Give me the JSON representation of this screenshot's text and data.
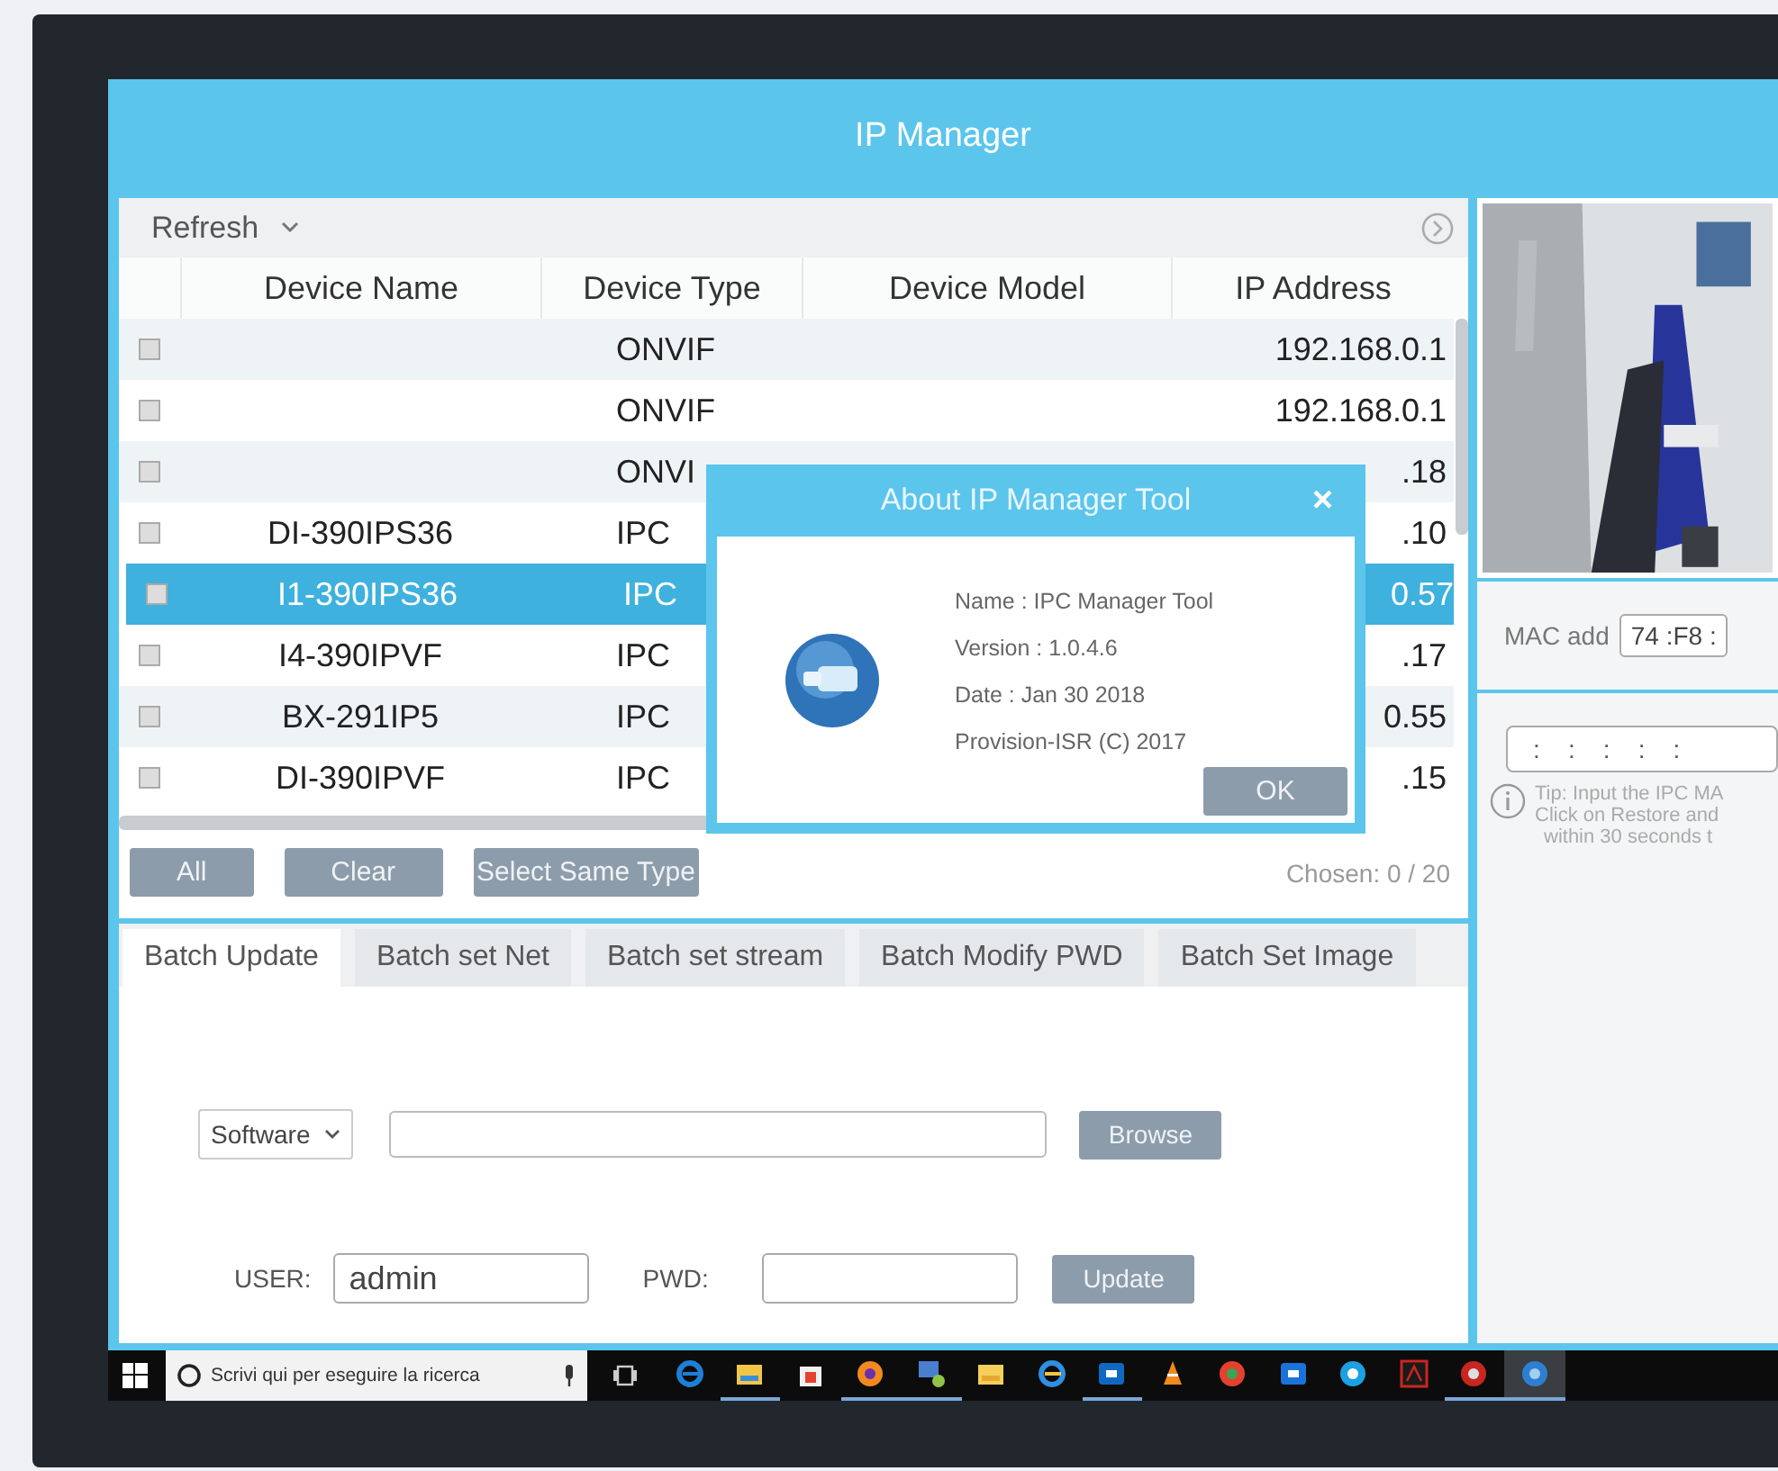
{
  "window": {
    "title": "IP Manager"
  },
  "toolbar": {
    "refresh": "Refresh"
  },
  "table": {
    "columns": [
      "Device Name",
      "Device Type",
      "Device Model",
      "IP Address"
    ],
    "rows": [
      {
        "checked": false,
        "selected": false,
        "type": "ONVIF",
        "ip": "192.168.0.1"
      },
      {
        "checked": false,
        "selected": false,
        "type": "ONVIF",
        "ip": "192.168.0.1"
      },
      {
        "checked": false,
        "selected": false,
        "type": "ONVI",
        "ip": ".18"
      },
      {
        "checked": false,
        "selected": false,
        "name": "DI-390IPS36",
        "type": "IPC",
        "ip": ".10"
      },
      {
        "checked": false,
        "selected": true,
        "name": "I1-390IPS36",
        "type": "IPC",
        "ip": "0.57"
      },
      {
        "checked": false,
        "selected": false,
        "name": "I4-390IPVF",
        "type": "IPC",
        "ip": ".17"
      },
      {
        "checked": false,
        "selected": false,
        "name": "BX-291IP5",
        "type": "IPC",
        "ip": "0.55"
      },
      {
        "checked": false,
        "selected": false,
        "name": "DI-390IPVF",
        "type": "IPC",
        "ip": ".15"
      }
    ]
  },
  "dialog": {
    "title": "About IP Manager Tool",
    "close": "×",
    "lines": [
      "Name : IPC Manager Tool",
      "Version : 1.0.4.6",
      "Date : Jan 30 2018",
      "Provision-ISR (C) 2017"
    ],
    "ok": "OK"
  },
  "actions": {
    "buttons": [
      "All",
      "Clear",
      "Select Same Type"
    ],
    "chosen": "Chosen:  0 / 20"
  },
  "mac": {
    "label": "MAC add",
    "value": "74 :F8 :",
    "second": ":    :    :    :    :"
  },
  "tip": [
    "Tip: Input the IPC MA",
    "Click on Restore and",
    "within 30 seconds t"
  ],
  "tabs": [
    {
      "label": "Batch Update",
      "selected": true
    },
    {
      "label": "Batch set Net",
      "selected": false
    },
    {
      "label": "Batch set stream",
      "selected": false
    },
    {
      "label": "Batch Modify PWD",
      "selected": false
    },
    {
      "label": "Batch Set Image",
      "selected": false
    }
  ],
  "form": {
    "select": "Software",
    "browse": "Browse",
    "user_label": "USER:",
    "user": "admin",
    "pwd_label": "PWD:",
    "update": "Update"
  },
  "taskbar": {
    "search": "Scrivi qui per eseguire la ricerca",
    "apps": [
      {
        "running": false,
        "selected": false
      },
      {
        "running": true,
        "selected": false
      },
      {
        "running": false,
        "selected": false
      },
      {
        "running": true,
        "selected": false
      },
      {
        "running": true,
        "selected": false
      },
      {
        "running": false,
        "selected": false
      },
      {
        "running": false,
        "selected": false
      },
      {
        "running": true,
        "selected": false
      },
      {
        "running": false,
        "selected": false
      },
      {
        "running": false,
        "selected": false
      },
      {
        "running": false,
        "selected": false
      },
      {
        "running": false,
        "selected": false
      },
      {
        "running": false,
        "selected": false
      },
      {
        "running": true,
        "selected": false
      },
      {
        "running": true,
        "selected": true
      }
    ]
  }
}
